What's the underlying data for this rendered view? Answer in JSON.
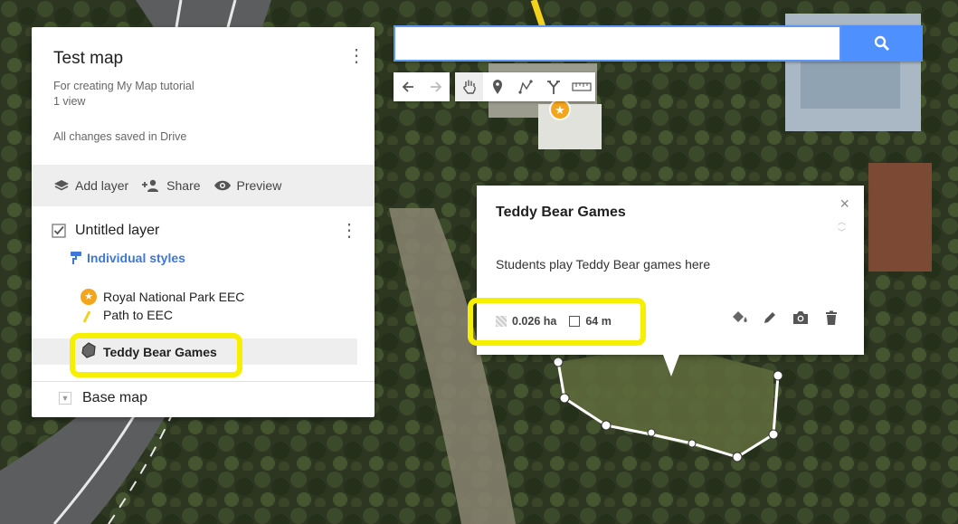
{
  "map": {
    "colors": {
      "trees": "#2f3a22",
      "road": "#5a5a5a",
      "path": "#8a8473",
      "lawn": "#5e6a3c"
    }
  },
  "panel": {
    "title": "Test map",
    "description": "For creating My Map tutorial",
    "views": "1 view",
    "save_status": "All changes saved in Drive",
    "actions": {
      "add_layer": "Add layer",
      "share": "Share",
      "preview": "Preview"
    },
    "layer": {
      "name": "Untitled layer",
      "checked": true,
      "styles_link": "Individual styles",
      "features": [
        {
          "label": "Royal National Park EEC",
          "icon": "orange-star-marker"
        },
        {
          "label": "Path to EEC",
          "icon": "yellow-line"
        },
        {
          "label": "Teddy Bear Games",
          "icon": "polygon-shape"
        }
      ]
    },
    "base_map": "Base map"
  },
  "search": {
    "value": "",
    "placeholder": ""
  },
  "tools": [
    {
      "name": "undo",
      "icon": "undo-arrow"
    },
    {
      "name": "redo",
      "icon": "redo-arrow"
    },
    {
      "name": "pan",
      "icon": "hand"
    },
    {
      "name": "add-marker",
      "icon": "pin"
    },
    {
      "name": "draw-line",
      "icon": "polyline"
    },
    {
      "name": "directions",
      "icon": "fork"
    },
    {
      "name": "measure",
      "icon": "ruler"
    }
  ],
  "popup": {
    "title": "Teddy Bear Games",
    "description": "Students play Teddy Bear games here",
    "area": "0.026 ha",
    "perimeter": "64 m",
    "actions": [
      "paint-bucket",
      "pencil",
      "camera",
      "trash"
    ]
  },
  "accent": "#4d90fe",
  "highlight_color": "#f6f000"
}
